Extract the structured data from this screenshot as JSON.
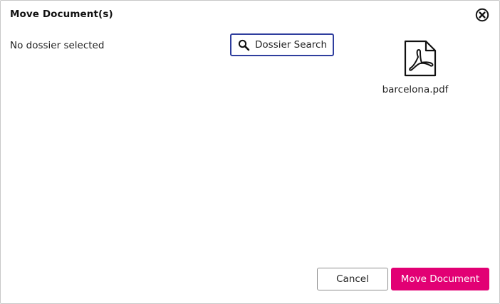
{
  "dialog": {
    "title": "Move Document(s)",
    "close_icon": "close-circle-icon"
  },
  "selection": {
    "status_text": "No dossier selected"
  },
  "search": {
    "label": "Dossier Search",
    "icon": "search-icon"
  },
  "document": {
    "icon": "pdf-icon",
    "file_name": "barcelona.pdf"
  },
  "footer": {
    "cancel_label": "Cancel",
    "move_label": "Move Document"
  },
  "colors": {
    "accent": "#e20074",
    "search_border": "#2f3e9e"
  }
}
